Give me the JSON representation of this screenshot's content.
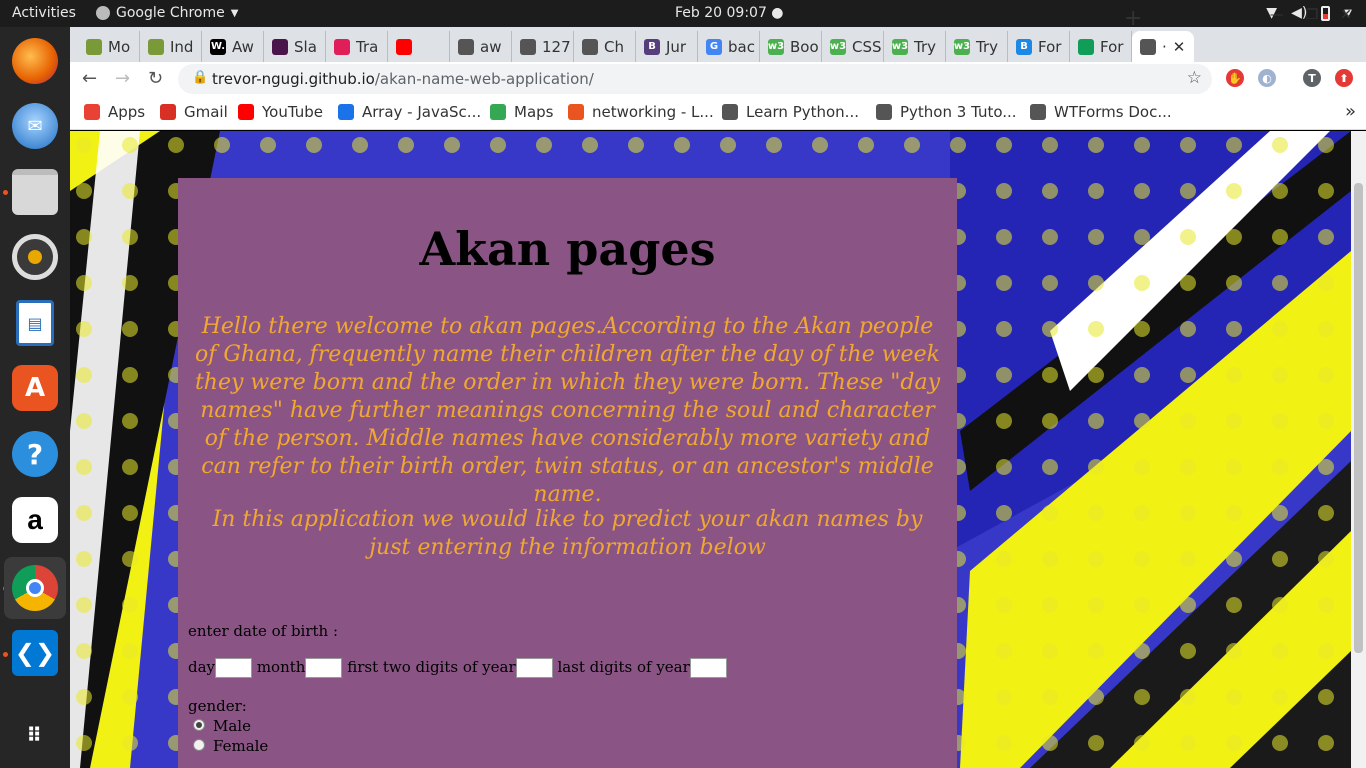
{
  "topbar": {
    "activities": "Activities",
    "app_name": "Google Chrome",
    "app_menu_icon": "chevron-down-icon",
    "clock": "Feb 20  09:07",
    "status_icons": [
      "wifi-icon",
      "volume-icon",
      "battery-icon",
      "power-menu-icon"
    ]
  },
  "dock": {
    "items": [
      {
        "name": "Firefox",
        "icon": "firefox-icon",
        "color": "#e66000"
      },
      {
        "name": "Thunderbird",
        "icon": "thunderbird-icon",
        "color": "#1f6fc5"
      },
      {
        "name": "Files",
        "icon": "files-icon",
        "color": "#cfcfcf"
      },
      {
        "name": "Rhythmbox",
        "icon": "rhythmbox-icon",
        "color": "#e8a800"
      },
      {
        "name": "LibreOffice Impress",
        "icon": "impress-icon",
        "color": "#2a6ebb"
      },
      {
        "name": "Ubuntu Software",
        "icon": "software-icon",
        "color": "#e95420"
      },
      {
        "name": "Help",
        "icon": "help-icon",
        "color": "#2c8fdd"
      },
      {
        "name": "Amazon",
        "icon": "amazon-icon",
        "color": "#ffffff"
      },
      {
        "name": "Google Chrome",
        "icon": "chrome-icon",
        "color": "#4285f4"
      },
      {
        "name": "Visual Studio Code",
        "icon": "vscode-icon",
        "color": "#0078d4"
      },
      {
        "name": "Show Applications",
        "icon": "grid-icon",
        "color": "#262626"
      }
    ]
  },
  "tabs": [
    {
      "label": "Mo",
      "color": "#7a9a3a"
    },
    {
      "label": "Ind",
      "color": "#7a9a3a"
    },
    {
      "label": "Aw",
      "color": "#000000",
      "glyph": "W."
    },
    {
      "label": "Sla",
      "color": "#4a154b"
    },
    {
      "label": "Tra",
      "color": "#e01e5a"
    },
    {
      "label": "",
      "color": "#ff0000"
    },
    {
      "label": "aw",
      "color": "#555555"
    },
    {
      "label": "127",
      "color": "#555555"
    },
    {
      "label": "Ch",
      "color": "#555555"
    },
    {
      "label": "Jur",
      "color": "#563d7c",
      "glyph": "B"
    },
    {
      "label": "bac",
      "color": "#4285f4",
      "glyph": "G"
    },
    {
      "label": "Boo",
      "color": "#4caf50",
      "glyph": "w3"
    },
    {
      "label": "CSS",
      "color": "#4caf50",
      "glyph": "w3"
    },
    {
      "label": "Try",
      "color": "#4caf50",
      "glyph": "w3"
    },
    {
      "label": "Try",
      "color": "#4caf50",
      "glyph": "w3"
    },
    {
      "label": "For",
      "color": "#1e88e5",
      "glyph": "B"
    },
    {
      "label": "For",
      "color": "#0f9d58"
    },
    {
      "label": "·",
      "color": "#555555",
      "active": true
    }
  ],
  "toolbar": {
    "url_host": "trevor-ngugi.github.io",
    "url_path": "/akan-name-web-application/",
    "profile_initial": "T"
  },
  "bookmarks": [
    {
      "label": "Apps",
      "icon": "apps-grid-icon",
      "color": "#e94235"
    },
    {
      "label": "Gmail",
      "icon": "gmail-icon",
      "color": "#d93025"
    },
    {
      "label": "YouTube",
      "icon": "youtube-icon",
      "color": "#ff0000"
    },
    {
      "label": "Array - JavaSc...",
      "icon": "mdn-icon",
      "color": "#1a73e8"
    },
    {
      "label": "Maps",
      "icon": "maps-icon",
      "color": "#34a853"
    },
    {
      "label": "networking - L...",
      "icon": "askubuntu-icon",
      "color": "#e95420"
    },
    {
      "label": "Learn Python...",
      "icon": "globe-icon",
      "color": "#555555"
    },
    {
      "label": "Python 3 Tuto...",
      "icon": "tutorial-icon",
      "color": "#555555"
    },
    {
      "label": "WTForms Doc...",
      "icon": "docs-icon",
      "color": "#555555"
    }
  ],
  "page": {
    "title": "Akan pages",
    "intro": "Hello there welcome to akan pages.According to the Akan people of Ghana, frequently name their children after the day of the week they were born and the order in which they were born. These \"day names\" have further meanings concerning the soul and character of the person. Middle names have considerably more variety and can refer to their birth order, twin status, or an ancestor's middle name.",
    "intro2": "In this application we would like to predict your akan names by just entering the information below",
    "dob_label": "enter date of birth :",
    "day_label": "day",
    "month_label": "month",
    "year_first_label": "first two digits of year",
    "year_last_label": "last digits of year",
    "gender_label": "gender:",
    "gender_options": [
      "Male",
      "Female"
    ],
    "panel_color": "#8a5585",
    "text_accent": "#f0a830"
  }
}
